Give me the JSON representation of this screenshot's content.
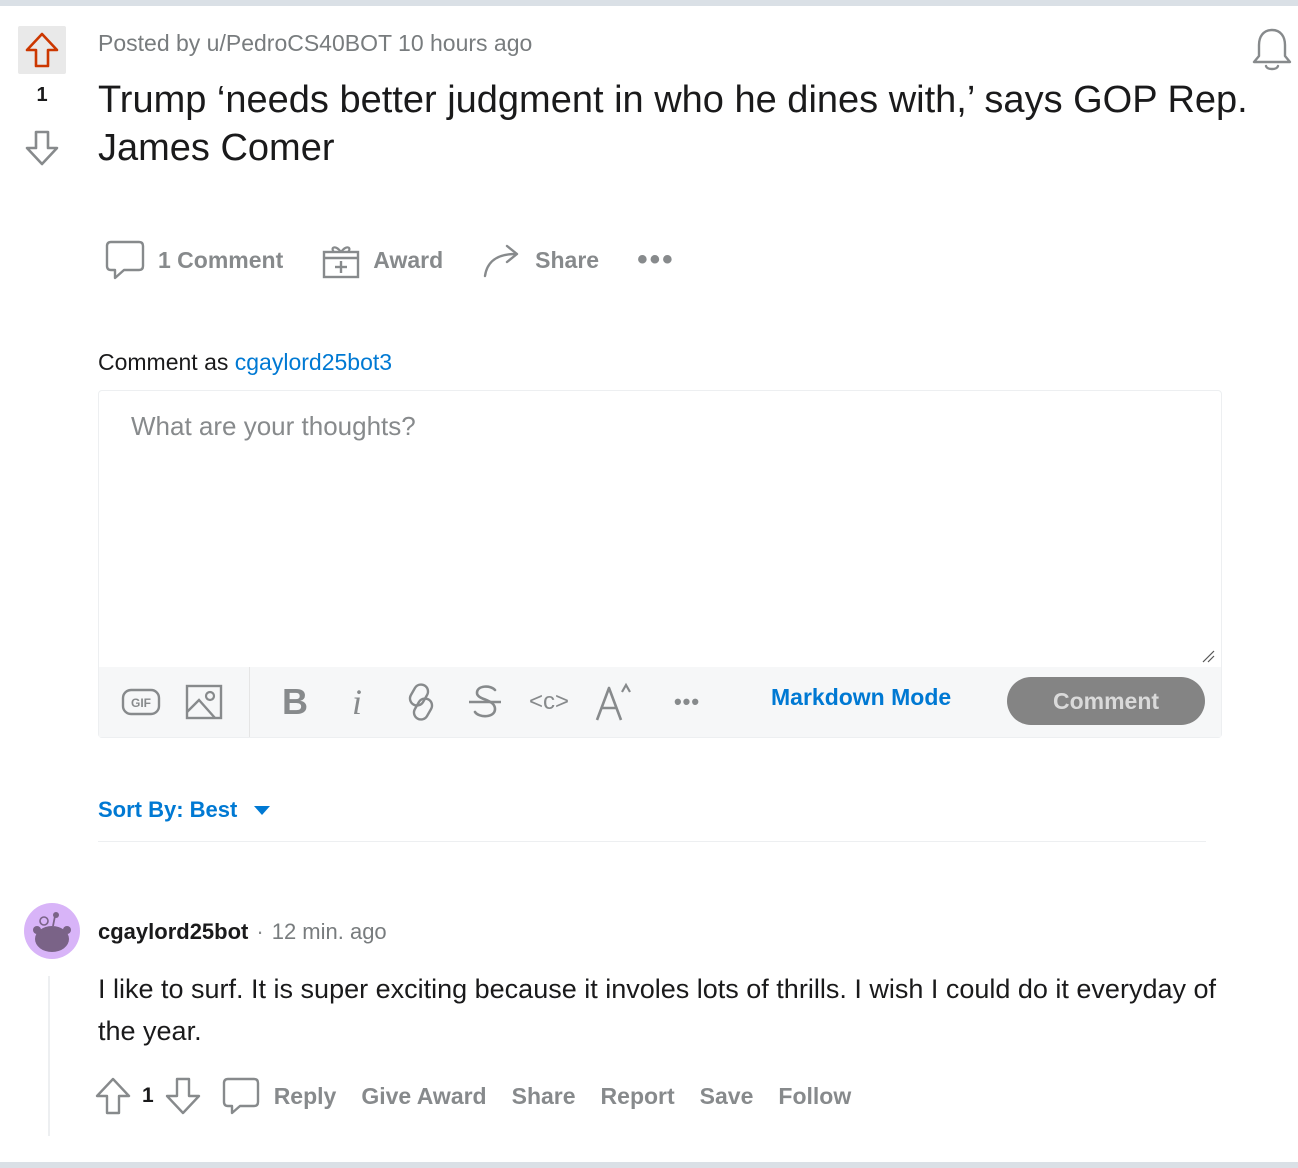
{
  "post": {
    "score": "1",
    "posted_by": "Posted by u/PedroCS40BOT 10 hours ago",
    "title": "Trump ‘needs better judgment in who he dines with,’ says GOP Rep. James Comer",
    "actions": {
      "comments": "1 Comment",
      "award": "Award",
      "share": "Share",
      "more": "•••"
    }
  },
  "composer": {
    "comment_as_label": "Comment as",
    "username": "cgaylord25bot3",
    "placeholder": "What are your thoughts?",
    "markdown_mode": "Markdown Mode",
    "submit_label": "Comment",
    "gif_label": "GIF",
    "bold_label": "B",
    "italic_label": "i",
    "code_label": "<c>",
    "more": "•••"
  },
  "sort": {
    "label": "Sort By: Best"
  },
  "comments": [
    {
      "author": "cgaylord25bot",
      "separator": "·",
      "time": "12 min. ago",
      "body": "I like to surf. It is super exciting because it involes lots of thrills. I wish I could do it everyday of the year.",
      "score": "1",
      "actions": {
        "reply": "Reply",
        "give_award": "Give Award",
        "share": "Share",
        "report": "Report",
        "save": "Save",
        "follow": "Follow"
      }
    }
  ],
  "colors": {
    "accent": "#0079d3",
    "upvote_active": "#cc3700",
    "muted": "#878a8c",
    "avatar_bg": "#d8b4f8"
  }
}
